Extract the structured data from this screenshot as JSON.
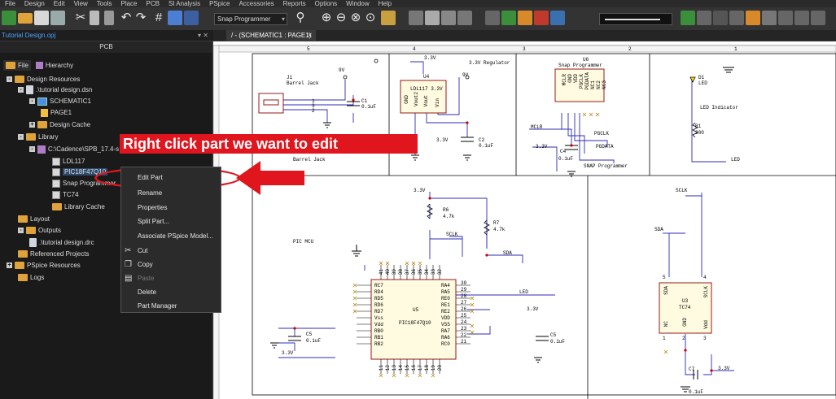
{
  "menu": [
    "File",
    "Design",
    "Edit",
    "View",
    "Tools",
    "Place",
    "PCB",
    "SI Analysis",
    "PSpice",
    "Accessories",
    "Reports",
    "Options",
    "Window",
    "Help"
  ],
  "toolbar": {
    "part_combo": "Snap Programmer",
    "icons": [
      "new-icon",
      "open-icon",
      "save-icon",
      "print-icon",
      "cut-icon",
      "copy-icon",
      "paste-icon",
      "undo-icon",
      "redo-icon",
      "grid-icon",
      "place-part-icon",
      "zoom-in-icon",
      "zoom-out-icon",
      "zoom-fit-icon",
      "zoom-area-icon"
    ]
  },
  "tabs": {
    "project": "Tutorial Design.opj",
    "project_controls": "▾ ✕",
    "schematic": "/ - (SCHEMATIC1 : PAGE1)",
    "schematic_close": "✕"
  },
  "panel": {
    "title": "PCB",
    "tab_file": "File",
    "tab_hierarchy": "Hierarchy"
  },
  "tree": [
    {
      "label": "Design Resources",
      "exp": "-",
      "icon": "fold"
    },
    {
      "label": ".\\tutorial design.dsn",
      "exp": "-",
      "icon": "file"
    },
    {
      "label": "SCHEMATIC1",
      "exp": "-",
      "icon": "schi"
    },
    {
      "label": "PAGE1",
      "exp": "",
      "icon": "page"
    },
    {
      "label": "Design Cache",
      "exp": "+",
      "icon": "fold"
    },
    {
      "label": "Library",
      "exp": "-",
      "icon": "fold"
    },
    {
      "label": "C:\\Cadence\\SPB_17.4-s",
      "exp": "-",
      "icon": "libi"
    },
    {
      "label": "LDL117",
      "exp": "",
      "icon": "parti"
    },
    {
      "label": "PIC18F47Q10",
      "exp": "",
      "icon": "parti",
      "selected": true
    },
    {
      "label": "Snap Programmer",
      "exp": "",
      "icon": "parti"
    },
    {
      "label": "TC74",
      "exp": "",
      "icon": "parti"
    },
    {
      "label": "Library Cache",
      "exp": "",
      "icon": "fold"
    },
    {
      "label": "Layout",
      "exp": "",
      "icon": "fold"
    },
    {
      "label": "Outputs",
      "exp": "-",
      "icon": "fold"
    },
    {
      "label": ".\\tutorial design.drc",
      "exp": "",
      "icon": "file"
    },
    {
      "label": "Referenced Projects",
      "exp": "",
      "icon": "fold"
    },
    {
      "label": "PSpice Resources",
      "exp": "+",
      "icon": "fold"
    },
    {
      "label": "Logs",
      "exp": "",
      "icon": "fold"
    }
  ],
  "context_menu": [
    {
      "label": "Edit Part",
      "icon": "",
      "disabled": false
    },
    {
      "label": "Rename",
      "icon": "",
      "disabled": false
    },
    {
      "label": "Properties",
      "icon": "",
      "disabled": false
    },
    {
      "label": "Split Part...",
      "icon": "",
      "disabled": false
    },
    {
      "label": "Associate PSpice Model...",
      "icon": "",
      "disabled": false
    },
    {
      "label": "Cut",
      "icon": "✂",
      "disabled": false
    },
    {
      "label": "Copy",
      "icon": "❐",
      "disabled": false
    },
    {
      "label": "Paste",
      "icon": "▤",
      "disabled": true
    },
    {
      "label": "Delete",
      "icon": "",
      "disabled": false
    },
    {
      "label": "Part Manager",
      "icon": "",
      "disabled": false
    }
  ],
  "annotation": "Right click part we want to edit",
  "schematic": {
    "j1_ref": "J1",
    "j1_val": "Barrel Jack",
    "j1_title": "Barrel Jack",
    "v9": "9V",
    "v9b": "9V",
    "c1_ref": "C1",
    "c1_val": "0.1uF",
    "v33_top": "3.3V",
    "reg_title": "3.3V Regulator",
    "u4_ref": "U4",
    "u4_val": "LDL117 3.3V",
    "u4_p1": "GND",
    "u4_p2": "Vout2",
    "u4_p3": "Vout",
    "u4_p4": "Vin",
    "c2_ref": "C2",
    "c2_val": "0.1uF",
    "v33_c2": "3.3V",
    "u6_ref": "U6",
    "u6_val": "Snap Programmer",
    "u6_pins": [
      "MCLR",
      "GND",
      "VDD",
      "PGCLK",
      "PGDATA",
      "NC1",
      "NC2",
      "NC3"
    ],
    "mclr": "MCLR",
    "pgclk": "PGCLK",
    "pgdata": "PGDATA",
    "c4_ref": "C4",
    "c4_val": "0.1uF",
    "v33_c4": "3.3V",
    "snap_title": "SNAP Programmer",
    "d1_ref": "D1",
    "d1_val": "LED",
    "led_title": "LED Indicator",
    "r1_ref": "R1",
    "r1_val": "200",
    "led_net": "LED",
    "v33_mid": "3.3V",
    "r6_ref": "R6",
    "r6_val": "4.7k",
    "r7_ref": "R7",
    "r7_val": "4.7k",
    "sclk": "SCLK",
    "sda": "SDA",
    "pic_title": "PIC MCU",
    "u5_ref": "U5",
    "u5_val": "PIC18F47Q10",
    "u5_left": [
      "RC7",
      "RD4",
      "RD5",
      "RD6",
      "RD7",
      "Vss",
      "Vdd",
      "RB0",
      "RB1",
      "RB2"
    ],
    "u5_right": [
      "RA4",
      "RA5",
      "RE0",
      "RE1",
      "RE2",
      "VDD",
      "VSS",
      "RA7",
      "RA6",
      "RC0"
    ],
    "u5_right_nums": [
      "30",
      "29",
      "28",
      "27",
      "26",
      "25",
      "24",
      "23",
      "22",
      "21"
    ],
    "u5_top_nums": [
      "41",
      "40",
      "39",
      "38",
      "37",
      "36",
      "35",
      "34",
      "33",
      "32"
    ],
    "u5_bot_nums": [
      "11",
      "12",
      "13",
      "14",
      "15",
      "16",
      "17",
      "18",
      "19",
      "20"
    ],
    "c5_ref": "C5",
    "c5_val": "0.1uF",
    "v33_c5": "3.3V",
    "c6_ref": "C5",
    "c6_val": "0.1uF",
    "v33_c6": "3.3V",
    "led_pic": "LED",
    "sclk2": "SCLK",
    "sda2": "SDA",
    "u3_ref": "U3",
    "u3_val": "TC74",
    "u3_p1": "SDA",
    "u3_p2": "SCLK",
    "u3_p3": "NC",
    "u3_p4": "GND",
    "u3_p5": "Vdd",
    "u3_n1": "5",
    "u3_n2": "4",
    "u3_n3": "1",
    "u3_n4": "2",
    "u3_n5": "3",
    "c7_ref": "C7",
    "c7_val": "0.1uF",
    "v33_c7": "3.3V",
    "border_cols": [
      "5",
      "4",
      "3",
      "2",
      "1"
    ]
  }
}
